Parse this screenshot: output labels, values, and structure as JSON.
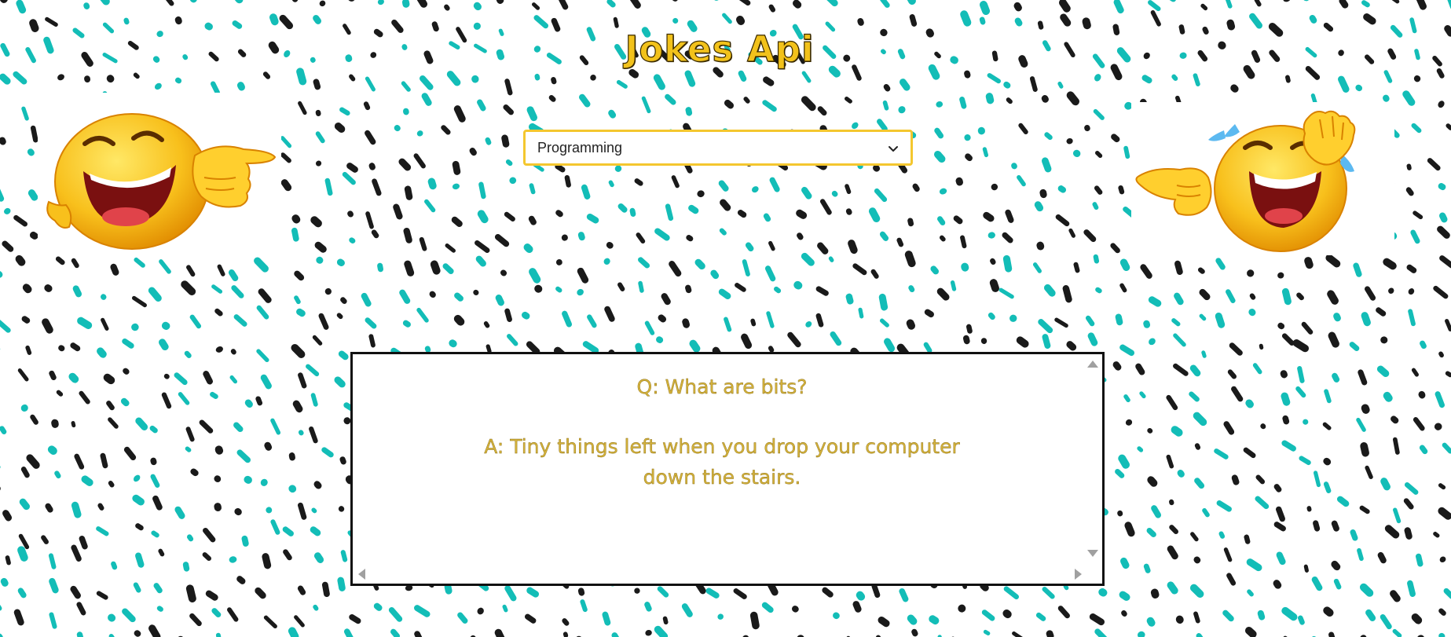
{
  "page": {
    "title": "Jokes Api"
  },
  "category_select": {
    "selected": "Programming"
  },
  "joke": {
    "question": "Q: What are bits?",
    "answer": "A: Tiny things left when you drop your computer down the stairs."
  },
  "colors": {
    "title_fill": "#f2c21b",
    "select_border": "#f4c72f",
    "joke_text": "#d4b23c",
    "pattern_teal": "#13bdb7",
    "pattern_black": "#1a1a1a"
  },
  "icons": {
    "select_arrow": "chevron-down-icon",
    "left_image": "laughing-pointing-emoji",
    "right_image": "crying-laughing-pointing-emoji"
  }
}
